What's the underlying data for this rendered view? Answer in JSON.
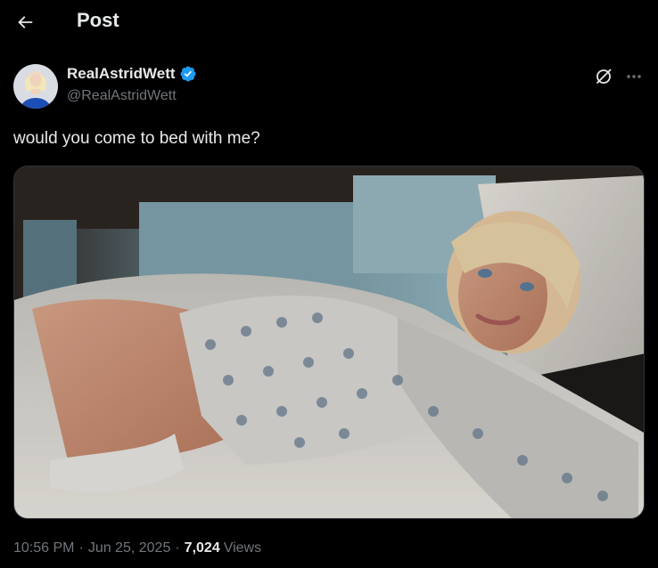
{
  "header": {
    "title": "Post"
  },
  "author": {
    "display_name": "RealAstridWett",
    "handle": "@RealAstridWett",
    "verified": true
  },
  "post": {
    "text": "would you come to bed with me?",
    "time": "10:56 PM",
    "date": "Jun 25, 2025",
    "separator": "·",
    "views_count": "7,024",
    "views_label": "Views"
  },
  "colors": {
    "background": "#000000",
    "text_primary": "#e7e9ea",
    "text_secondary": "#71767b",
    "verified_blue": "#1d9bf0",
    "border": "#2f3336"
  },
  "icons": {
    "back": "arrow-left-icon",
    "verified": "verified-badge-icon",
    "grok": "grok-icon",
    "more": "more-horizontal-icon"
  }
}
